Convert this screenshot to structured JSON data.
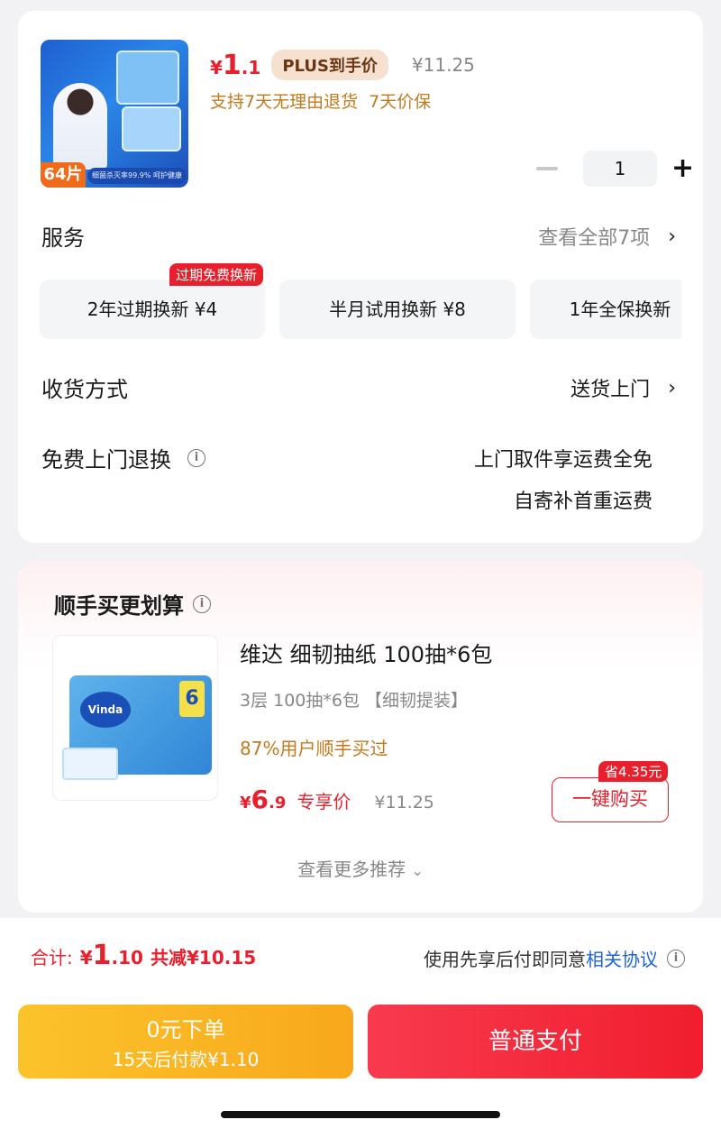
{
  "product": {
    "thumb_badge": "64片",
    "thumb_tag": "细菌杀灭率99.9% 呵护健康",
    "currency": "¥",
    "price_int": "1",
    "price_dec": ".1",
    "plus_label": "PLUS到手价",
    "original_price": "¥11.25",
    "guarantee": "支持7天无理由退货  7天价保",
    "quantity": "1"
  },
  "service": {
    "title": "服务",
    "view_all": "查看全部7项",
    "badge": "过期免费换新",
    "chips": [
      "2年过期换新  ¥4",
      "半月试用换新  ¥8",
      "1年全保换新"
    ]
  },
  "delivery": {
    "title": "收货方式",
    "value": "送货上门"
  },
  "return": {
    "title": "免费上门退换",
    "line1": "上门取件享运费全免",
    "line2": "自寄补首重运费"
  },
  "recommend": {
    "title": "顺手买更划算",
    "name": "维达 细韧抽纸 100抽*6包",
    "spec": "3层 100抽*6包 【细韧提装】",
    "bought": "87%用户顺手买过",
    "currency": "¥",
    "price_int": "6",
    "price_dec": ".9",
    "exclusive": "专享价",
    "original_price": "¥11.25",
    "save_tag": "省4.35元",
    "buy_label": "一键购买",
    "more": "查看更多推荐"
  },
  "footer": {
    "total_label": "合计:",
    "currency": "¥",
    "total_int": "1",
    "total_dec": ".10",
    "saved": "共减¥10.15",
    "agree_text": "使用先享后付即同意",
    "agree_link": "相关协议",
    "pay_later_line1": "0元下单",
    "pay_later_line2": "15天后付款¥1.10",
    "pay_label": "普通支付"
  }
}
